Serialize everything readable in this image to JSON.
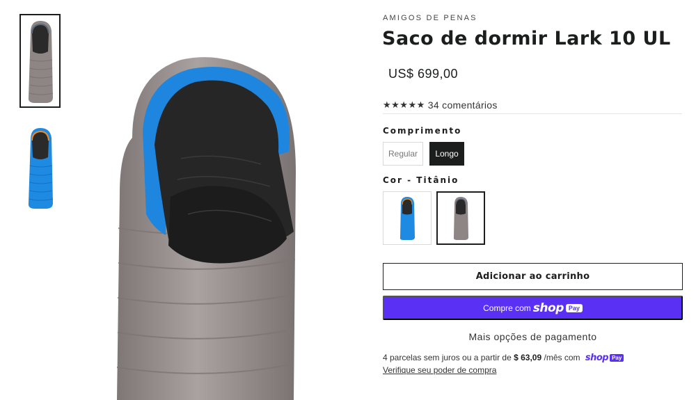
{
  "gallery": {
    "thumbnails": [
      {
        "color_name": "Titânio",
        "colors": {
          "body": "#8d8685",
          "liner": "#2a2a2a",
          "accent": "#5a6a7c"
        }
      },
      {
        "color_name": "Azul",
        "colors": {
          "body": "#1f8ae2",
          "liner": "#2a2a2a",
          "accent": "#f08a23"
        }
      }
    ],
    "main_colors": {
      "body": "#968f8e",
      "hood_trim": "#1f86e0",
      "liner": "#262626"
    }
  },
  "product": {
    "vendor": "AMIGOS DE PENAS",
    "title": "Saco de dormir Lark 10 UL",
    "price": "US$ 699,00"
  },
  "rating": {
    "stars": "★★★★★",
    "value": 5,
    "count_text": "34 comentários"
  },
  "options": {
    "length": {
      "label": "Comprimento",
      "values": [
        "Regular",
        "Longo"
      ],
      "selected": "Longo"
    },
    "color": {
      "label": "Cor - Titânio",
      "selected": "Titânio"
    }
  },
  "actions": {
    "add_to_cart": "Adicionar ao carrinho",
    "shop_pay_prefix": "Compre com",
    "shop_word": "shop",
    "pay_badge": "Pay",
    "more_payment": "Mais opções de pagamento"
  },
  "installments": {
    "text_before": "4 parcelas sem juros ou a partir de",
    "amount": "$ 63,09",
    "text_after": "/mês com",
    "shop_word": "shop",
    "pay_badge": "Pay",
    "link": "Verifique seu poder de compra"
  },
  "colors": {
    "shop_pay_purple": "#5a31f4",
    "selected_dark": "#1c1d1d"
  }
}
